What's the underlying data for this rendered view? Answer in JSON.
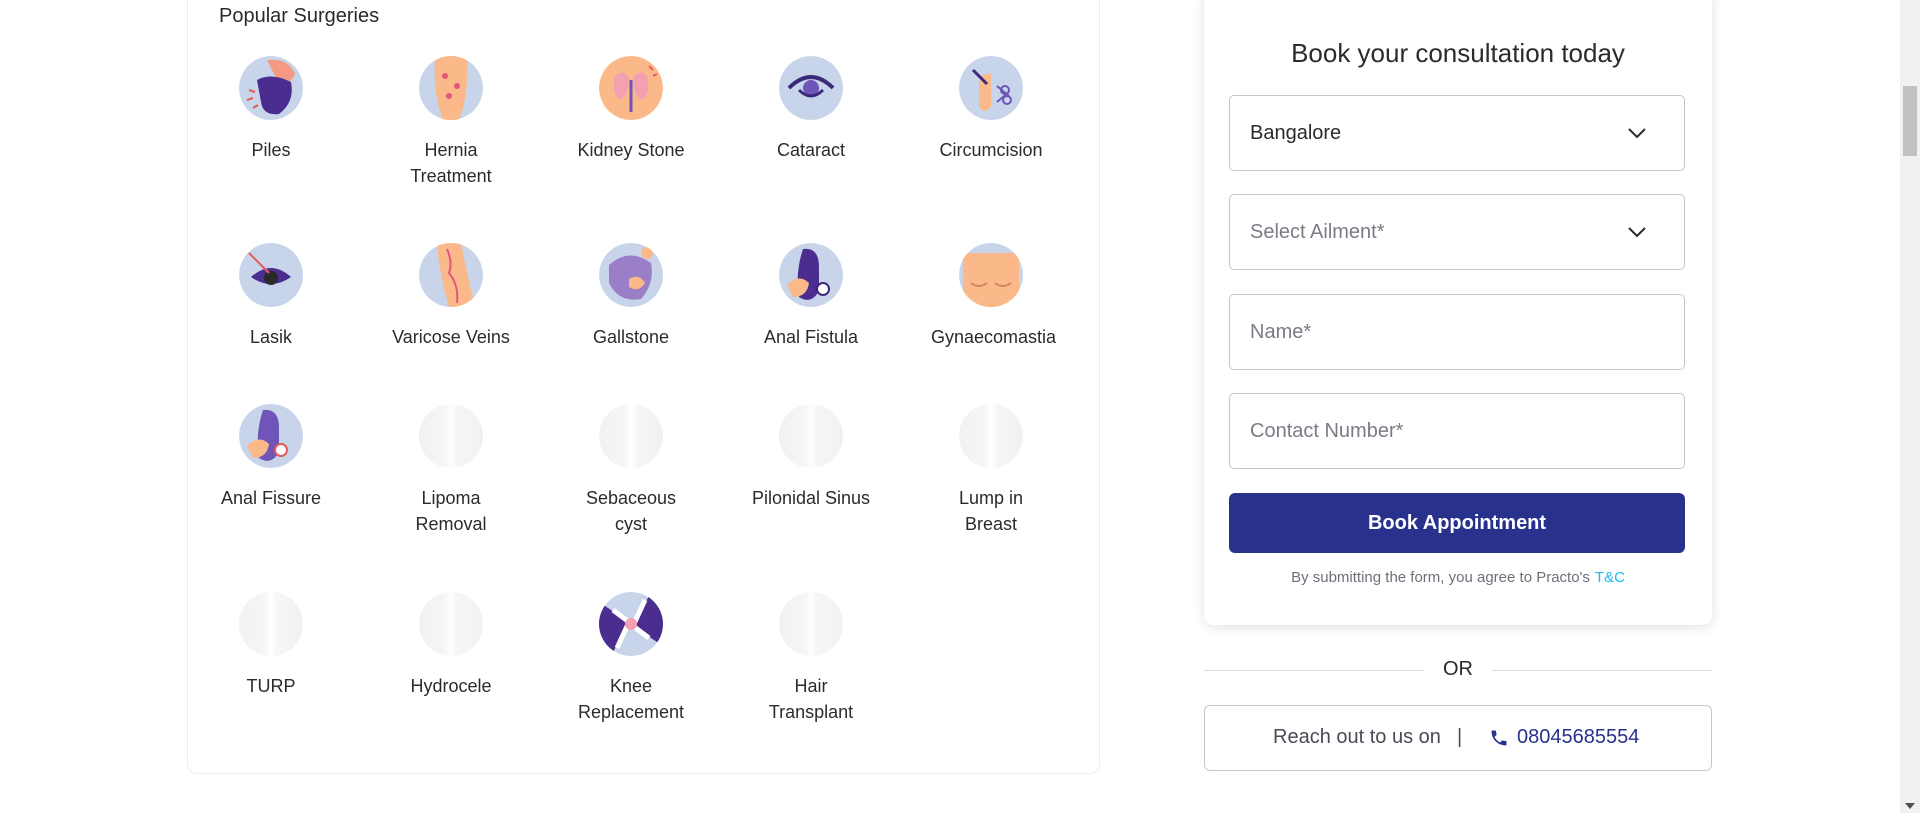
{
  "popular": {
    "title": "Popular Surgeries",
    "items": [
      {
        "label": "Piles"
      },
      {
        "label": "Hernia Treatment"
      },
      {
        "label": "Kidney Stone"
      },
      {
        "label": "Cataract"
      },
      {
        "label": "Circumcision"
      },
      {
        "label": "Lasik"
      },
      {
        "label": "Varicose Veins"
      },
      {
        "label": "Gallstone"
      },
      {
        "label": "Anal Fistula"
      },
      {
        "label": "Gynaecomastia"
      },
      {
        "label": "Anal Fissure"
      },
      {
        "label": "Lipoma Removal"
      },
      {
        "label": "Sebaceous cyst"
      },
      {
        "label": "Pilonidal Sinus"
      },
      {
        "label": "Lump in Breast"
      },
      {
        "label": "TURP"
      },
      {
        "label": "Hydrocele"
      },
      {
        "label": "Knee Replacement"
      },
      {
        "label": "Hair Transplant"
      }
    ]
  },
  "form": {
    "title": "Book your consultation today",
    "city": {
      "value": "Bangalore"
    },
    "ailment": {
      "placeholder": "Select Ailment*"
    },
    "name": {
      "placeholder": "Name*"
    },
    "contact": {
      "placeholder": "Contact Number*"
    },
    "submit_label": "Book Appointment",
    "tnc_text": "By submitting the form, you agree to Practo's",
    "tnc_link": "T&C"
  },
  "or_label": "OR",
  "reach": {
    "text": "Reach out to us on",
    "separator": "|",
    "phone": "08045685554"
  },
  "colors": {
    "primary": "#28328c",
    "link": "#14bef0",
    "border": "#c6c6cc"
  }
}
